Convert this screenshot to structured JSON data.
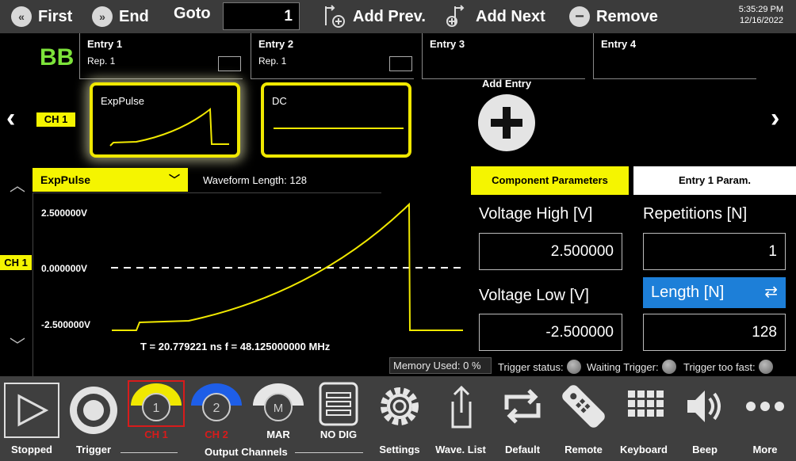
{
  "toolbar": {
    "first_label": "First",
    "end_label": "End",
    "goto_label": "Goto",
    "goto_value": "1",
    "add_prev_label": "Add Prev.",
    "add_next_label": "Add Next",
    "remove_label": "Remove",
    "time": "5:35:29 PM",
    "date": "12/16/2022"
  },
  "sequence": {
    "mode_badge": "BB",
    "channel_label": "CH 1",
    "entries": [
      {
        "name": "Entry  1",
        "rep": "Rep.  1"
      },
      {
        "name": "Entry  2",
        "rep": "Rep.  1"
      },
      {
        "name": "Entry  3"
      },
      {
        "name": "Entry  4"
      }
    ],
    "cards": [
      {
        "name": "ExpPulse"
      },
      {
        "name": "DC"
      }
    ],
    "add_entry_label": "Add Entry"
  },
  "waveform": {
    "selected": "ExpPulse",
    "length_label": "Waveform Length:  128",
    "channel_label": "CH 1",
    "y_high": "2.500000V",
    "y_mid": "0.000000V",
    "y_low": "-2.500000V",
    "readout": "T =  20.779221 ns   f =  48.125000000 MHz"
  },
  "params": {
    "tab_component": "Component Parameters",
    "tab_entry": "Entry  1  Param.",
    "voltage_high_label": "Voltage High [V]",
    "voltage_high_value": "2.500000",
    "voltage_low_label": "Voltage Low [V]",
    "voltage_low_value": "-2.500000",
    "repetitions_label": "Repetitions [N]",
    "repetitions_value": "1",
    "length_label": "Length [N]",
    "length_value": "128"
  },
  "status": {
    "memory_label": "Memory Used:   0 %",
    "trigger_status": "Trigger status:",
    "waiting_trigger": "Waiting Trigger:",
    "trigger_too_fast": "Trigger too fast:"
  },
  "dock": {
    "stopped": "Stopped",
    "trigger": "Trigger",
    "ch1": "CH 1",
    "ch1_number": "1",
    "ch2": "CH 2",
    "ch2_number": "2",
    "mar": "MAR",
    "mar_letter": "M",
    "no_dig": "NO DIG",
    "output_channels": "Output Channels",
    "settings": "Settings",
    "wave_list": "Wave. List",
    "default": "Default",
    "remote": "Remote",
    "keyboard": "Keyboard",
    "beep": "Beep",
    "more": "More"
  },
  "colors": {
    "accent_yellow": "#f5f500",
    "badge_green": "#7de33a",
    "length_blue": "#1d7fd8",
    "ch1_color": "#f0e800",
    "ch2_color": "#1e5ee8",
    "selected_red": "#d81b1b"
  }
}
